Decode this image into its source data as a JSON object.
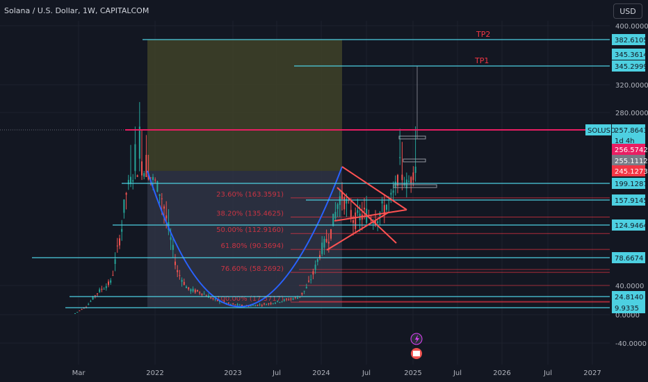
{
  "header": {
    "title": "Solana / U.S. Dollar, 1W, CAPITALCOM",
    "currency": "USD"
  },
  "chart_data": {
    "type": "candlestick",
    "symbol": "SOLUSD",
    "timeframe": "1W",
    "y_ticks": [
      "400.0000",
      "320.0000",
      "280.0000",
      "40.0000",
      "0.0000",
      "-40.0000"
    ],
    "x_ticks": [
      "Mar",
      "2022",
      "2023",
      "Jul",
      "2024",
      "Jul",
      "2025",
      "Jul",
      "2026",
      "Jul",
      "2027"
    ],
    "price_badges": [
      {
        "value": "382.6105",
        "color": "#4dd0e1"
      },
      {
        "value": "345.3614",
        "color": "#4dd0e1"
      },
      {
        "value": "345.2999",
        "color": "#4dd0e1"
      },
      {
        "value": "257.8643",
        "color": "#4dd0e1",
        "extra": "1d 4h"
      },
      {
        "value": "256.5742",
        "color": "#e91e63"
      },
      {
        "value": "255.1112",
        "color": "#787b86"
      },
      {
        "value": "245.1273",
        "color": "#f23645"
      },
      {
        "value": "199.1287",
        "color": "#4dd0e1"
      },
      {
        "value": "157.9145",
        "color": "#4dd0e1"
      },
      {
        "value": "124.9464",
        "color": "#4dd0e1"
      },
      {
        "value": "78.6674",
        "color": "#4dd0e1"
      },
      {
        "value": "24.8140",
        "color": "#4dd0e1"
      },
      {
        "value": "9.9335",
        "color": "#4dd0e1"
      }
    ],
    "symbol_tag": "SOLUSD",
    "fib_levels": [
      {
        "label": "23.60% (163.3591)",
        "value": 163.3591
      },
      {
        "label": "38.20% (135.4625)",
        "value": 135.4625
      },
      {
        "label": "50.00% (112.9160)",
        "value": 112.916
      },
      {
        "label": "61.80% (90.3694)",
        "value": 90.3694
      },
      {
        "label": "76.60% (58.2692)",
        "value": 58.2692
      },
      {
        "label": "100.00% (17.3717)",
        "value": 17.3717
      }
    ],
    "targets": [
      {
        "label": "TP2",
        "value": 382.6105
      },
      {
        "label": "TP1",
        "value": 345.2999
      }
    ],
    "horizontal_levels": [
      382.6105,
      345.2999,
      257.8643,
      199.1287,
      157.9145,
      124.9464,
      78.6674,
      24.814,
      9.9335
    ],
    "colors": {
      "background": "#131722",
      "level": "#4dd0e1",
      "pink": "#e91e63",
      "fib": "#f23645",
      "cup": "#2962ff",
      "up": "#26a69a",
      "down": "#ef5350"
    }
  }
}
